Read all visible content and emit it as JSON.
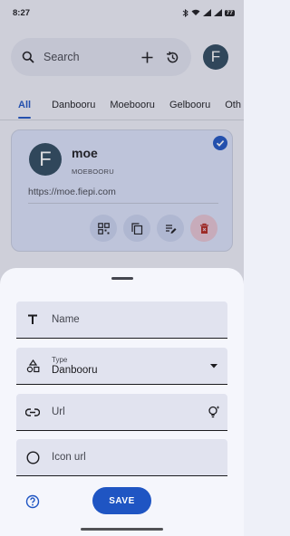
{
  "status": {
    "time": "8:27",
    "battery": "77"
  },
  "search": {
    "placeholder": "Search"
  },
  "profile": {
    "initial": "F"
  },
  "tabs": [
    {
      "label": "All",
      "active": true
    },
    {
      "label": "Danbooru"
    },
    {
      "label": "Moebooru"
    },
    {
      "label": "Gelbooru"
    },
    {
      "label": "Oth"
    }
  ],
  "card": {
    "initial": "F",
    "name": "moe",
    "type": "MOEBOORU",
    "url": "https://moe.fiepi.com",
    "selected": true,
    "actions": [
      "qr-code-icon",
      "copy-icon",
      "edit-icon",
      "delete-icon"
    ]
  },
  "sheet": {
    "name_label": "Name",
    "type_label": "Type",
    "type_value": "Danbooru",
    "url_label": "Url",
    "icon_url_label": "Icon url",
    "save_label": "SAVE"
  },
  "colors": {
    "accent": "#1f55c3",
    "card_bg": "#dbe2f9",
    "field_bg": "#e1e3ef",
    "sheet_bg": "#f5f6fc"
  }
}
